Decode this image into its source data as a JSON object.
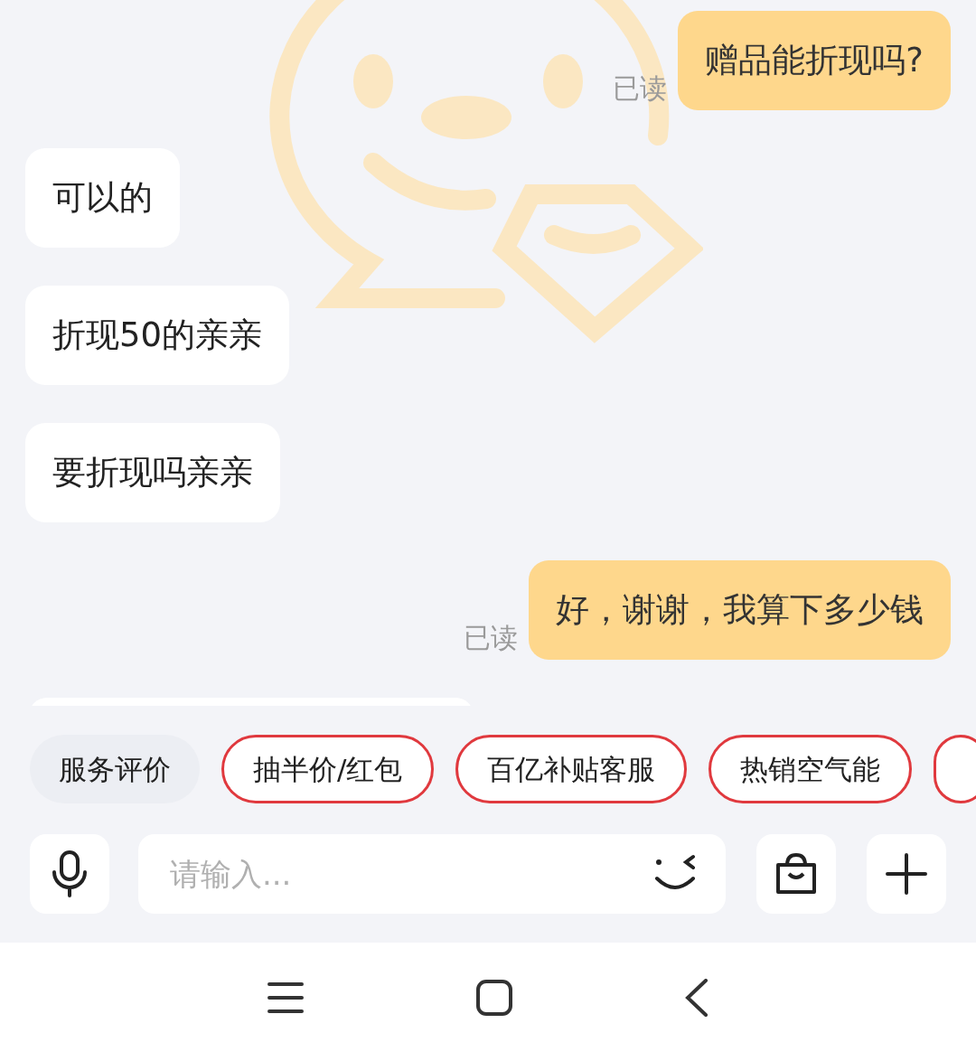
{
  "messages": [
    {
      "kind": "sent",
      "text": "赠品能折现吗?",
      "status": "已读"
    },
    {
      "kind": "received",
      "text": "可以的"
    },
    {
      "kind": "received",
      "text": "折现50的亲亲"
    },
    {
      "kind": "received",
      "text": "要折现吗亲亲"
    },
    {
      "kind": "sent",
      "text": "好，谢谢，我算下多少钱",
      "status": "已读"
    }
  ],
  "quick_replies": [
    {
      "label": "服务评价",
      "kind": "plain"
    },
    {
      "label": "抽半价/红包",
      "kind": "outlined"
    },
    {
      "label": "百亿补贴客服",
      "kind": "outlined"
    },
    {
      "label": "热销空气能",
      "kind": "outlined"
    }
  ],
  "input": {
    "placeholder": "请输入..."
  }
}
